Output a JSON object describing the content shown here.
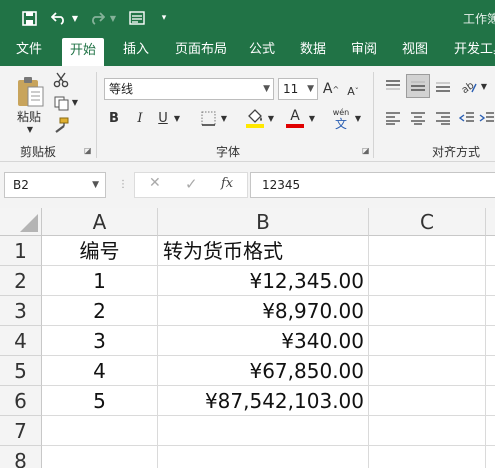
{
  "titlebar": {
    "workbook_title": "工作簿"
  },
  "ribbon_tabs": [
    "文件",
    "开始",
    "插入",
    "页面布局",
    "公式",
    "数据",
    "审阅",
    "视图",
    "开发工具"
  ],
  "clipboard": {
    "paste_label": "粘贴",
    "group_label": "剪贴板"
  },
  "font": {
    "font_name": "等线",
    "font_size": "11",
    "bold": "B",
    "italic": "I",
    "underline": "U",
    "grow": "A",
    "shrink": "A",
    "font_color_glyph": "A",
    "phonetic_top": "wén",
    "phonetic_bottom": "文",
    "group_label": "字体"
  },
  "alignment": {
    "group_label": "对齐方式"
  },
  "formula_bar": {
    "name_box": "B2",
    "fx": "fx",
    "cancel": "✕",
    "confirm": "✓",
    "content": "12345"
  },
  "grid": {
    "columns": [
      "A",
      "B",
      "C"
    ],
    "rows": [
      "1",
      "2",
      "3",
      "4",
      "5",
      "6",
      "7",
      "8"
    ],
    "cells": [
      [
        "编号",
        "转为货币格式",
        ""
      ],
      [
        "1",
        "¥12,345.00",
        ""
      ],
      [
        "2",
        "¥8,970.00",
        ""
      ],
      [
        "3",
        "¥340.00",
        ""
      ],
      [
        "4",
        "¥67,850.00",
        ""
      ],
      [
        "5",
        "¥87,542,103.00",
        ""
      ],
      [
        "",
        "",
        ""
      ],
      [
        "",
        "",
        ""
      ]
    ]
  },
  "colors": {
    "excel_green": "#217346",
    "font_color_red": "#e00000",
    "highlight_yellow": "#ffe800"
  }
}
